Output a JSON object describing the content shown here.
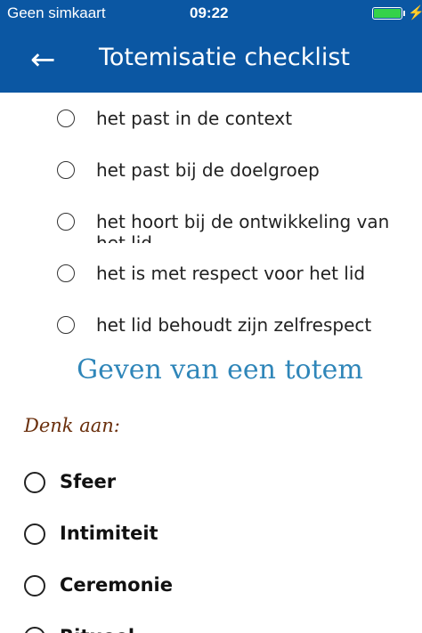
{
  "status": {
    "carrier": "Geen simkaart",
    "time": "09:22",
    "battery_level": 1.0
  },
  "header": {
    "back_icon": "arrow-left-icon",
    "title": "Totemisatie checklist"
  },
  "checklist": [
    {
      "label": "het past in de context"
    },
    {
      "label": "het past bij de doelgroep"
    },
    {
      "label": "het hoort bij de ontwikkeling van het lid"
    },
    {
      "label": "het is met respect voor het lid"
    },
    {
      "label": "het lid behoudt zijn zelfrespect"
    }
  ],
  "section": {
    "title": "Geven van een totem",
    "subtitle": "Denk aan:"
  },
  "considerations": [
    {
      "label": "Sfeer"
    },
    {
      "label": "Intimiteit"
    },
    {
      "label": "Ceremonie"
    },
    {
      "label": "Ritueel"
    }
  ],
  "colors": {
    "header_bg": "#0b57a3",
    "section_title": "#2f86b9",
    "subtitle": "#6a2f0c",
    "battery": "#35d24a"
  }
}
